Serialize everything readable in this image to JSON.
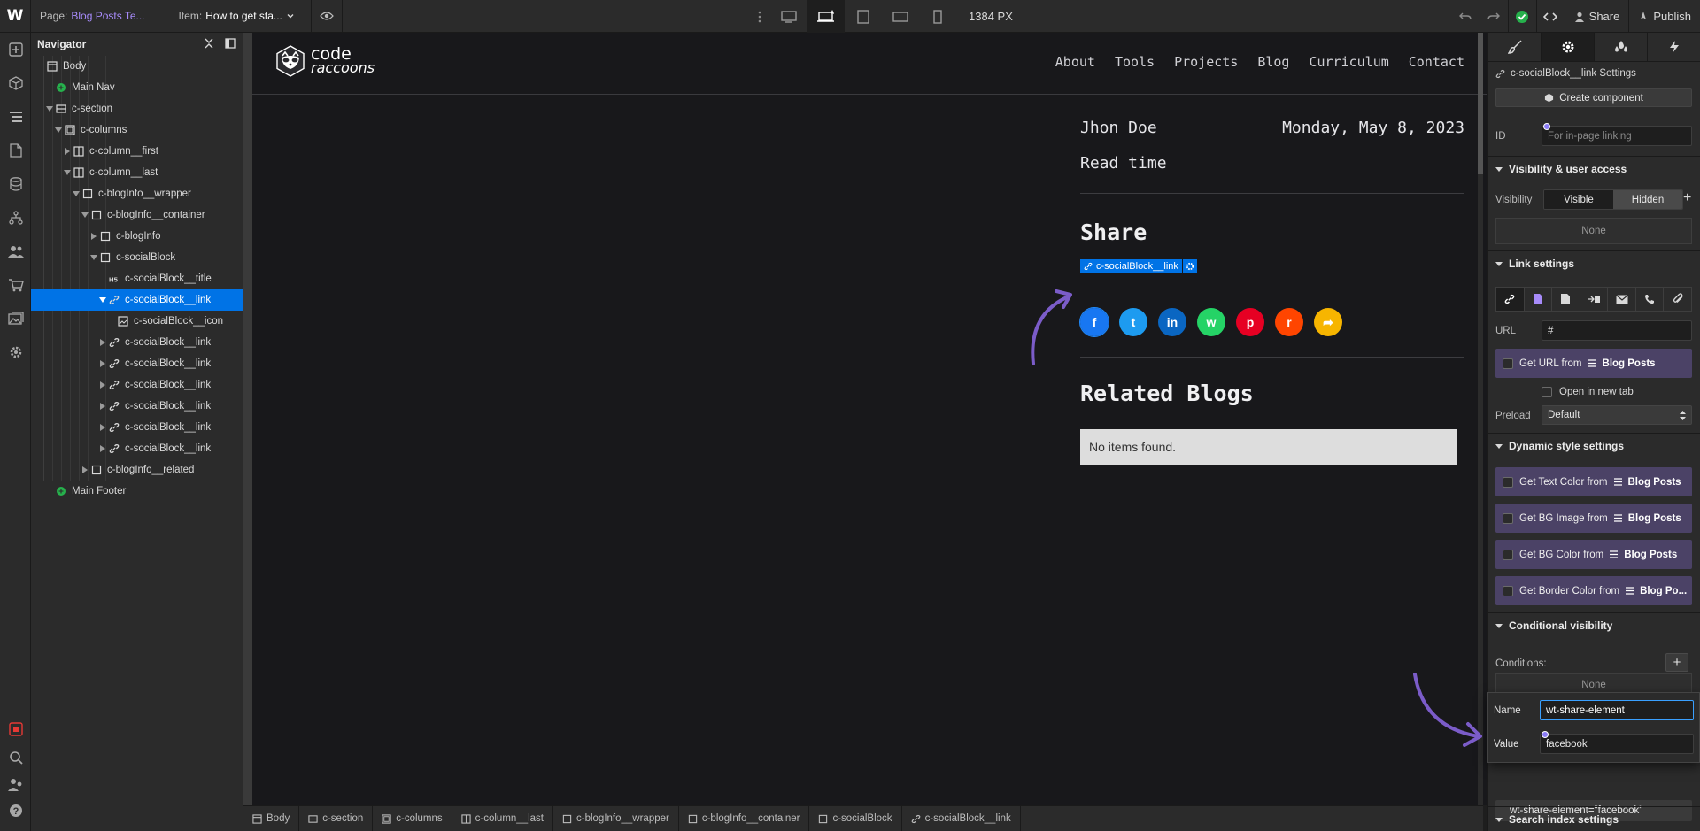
{
  "topbar": {
    "logo": "W",
    "page_label": "Page:",
    "page_value": "Blog Posts Te...",
    "item_label": "Item:",
    "item_value": "How to get sta...",
    "width_readout": "1384 PX",
    "share_label": "Share",
    "publish_label": "Publish"
  },
  "navigator": {
    "title": "Navigator",
    "items": [
      {
        "label": "Body"
      },
      {
        "label": "Main Nav"
      },
      {
        "label": "c-section"
      },
      {
        "label": "c-columns"
      },
      {
        "label": "c-column__first"
      },
      {
        "label": "c-column__last"
      },
      {
        "label": "c-blogInfo__wrapper"
      },
      {
        "label": "c-blogInfo__container"
      },
      {
        "label": "c-blogInfo"
      },
      {
        "label": "c-socialBlock"
      },
      {
        "label": "c-socialBlock__title"
      },
      {
        "label": "c-socialBlock__link"
      },
      {
        "label": "c-socialBlock__icon"
      },
      {
        "label": "c-socialBlock__link"
      },
      {
        "label": "c-socialBlock__link"
      },
      {
        "label": "c-socialBlock__link"
      },
      {
        "label": "c-socialBlock__link"
      },
      {
        "label": "c-socialBlock__link"
      },
      {
        "label": "c-socialBlock__link"
      },
      {
        "label": "c-blogInfo__related"
      },
      {
        "label": "Main Footer"
      }
    ]
  },
  "site": {
    "logo_line1": "code",
    "logo_line2": "raccoons",
    "menu": [
      "About",
      "Tools",
      "Projects",
      "Blog",
      "Curriculum",
      "Contact"
    ],
    "author": "Jhon Doe",
    "date": "Monday, May 8, 2023",
    "read_time": "Read time",
    "share_title": "Share",
    "selected_tag": "c-socialBlock__link",
    "socials": [
      {
        "name": "facebook",
        "color": "#1877f2",
        "glyph": "f"
      },
      {
        "name": "twitter",
        "color": "#1d9bf0",
        "glyph": "t"
      },
      {
        "name": "linkedin",
        "color": "#0a66c2",
        "glyph": "in"
      },
      {
        "name": "whatsapp",
        "color": "#25d366",
        "glyph": "w"
      },
      {
        "name": "pinterest",
        "color": "#e60023",
        "glyph": "p"
      },
      {
        "name": "reddit",
        "color": "#ff4500",
        "glyph": "r"
      },
      {
        "name": "share",
        "color": "#f7b500",
        "glyph": "➦"
      }
    ],
    "related_title": "Related Blogs",
    "empty_text": "No items found."
  },
  "breadcrumb": [
    "Body",
    "c-section",
    "c-columns",
    "c-column__last",
    "c-blogInfo__wrapper",
    "c-blogInfo__container",
    "c-socialBlock",
    "c-socialBlock__link"
  ],
  "panel": {
    "settings_title": "c-socialBlock__link Settings",
    "create_component": "Create component",
    "id_label": "ID",
    "id_placeholder": "For in-page linking",
    "visibility_section": "Visibility & user access",
    "visibility_label": "Visibility",
    "visible": "Visible",
    "hidden": "Hidden",
    "none": "None",
    "link_section": "Link settings",
    "url_label": "URL",
    "url_value": "#",
    "get_url_from": "Get URL from",
    "collection": "Blog Posts",
    "open_new_tab": "Open in new tab",
    "preload_label": "Preload",
    "preload_value": "Default",
    "dynamic_section": "Dynamic style settings",
    "dyn_text": "Get Text Color from",
    "dyn_bgimg": "Get BG Image from",
    "dyn_bgcolor": "Get BG Color from",
    "dyn_border": "Get Border Color from",
    "collection_short": "Blog Po...",
    "conditional_section": "Conditional visibility",
    "conditions_label": "Conditions:",
    "name_label": "Name",
    "name_value": "wt-share-element",
    "value_label": "Value",
    "value_value": "facebook",
    "attr_preview": "wt-share-element=\"facebook\"",
    "search_section": "Search index settings"
  }
}
